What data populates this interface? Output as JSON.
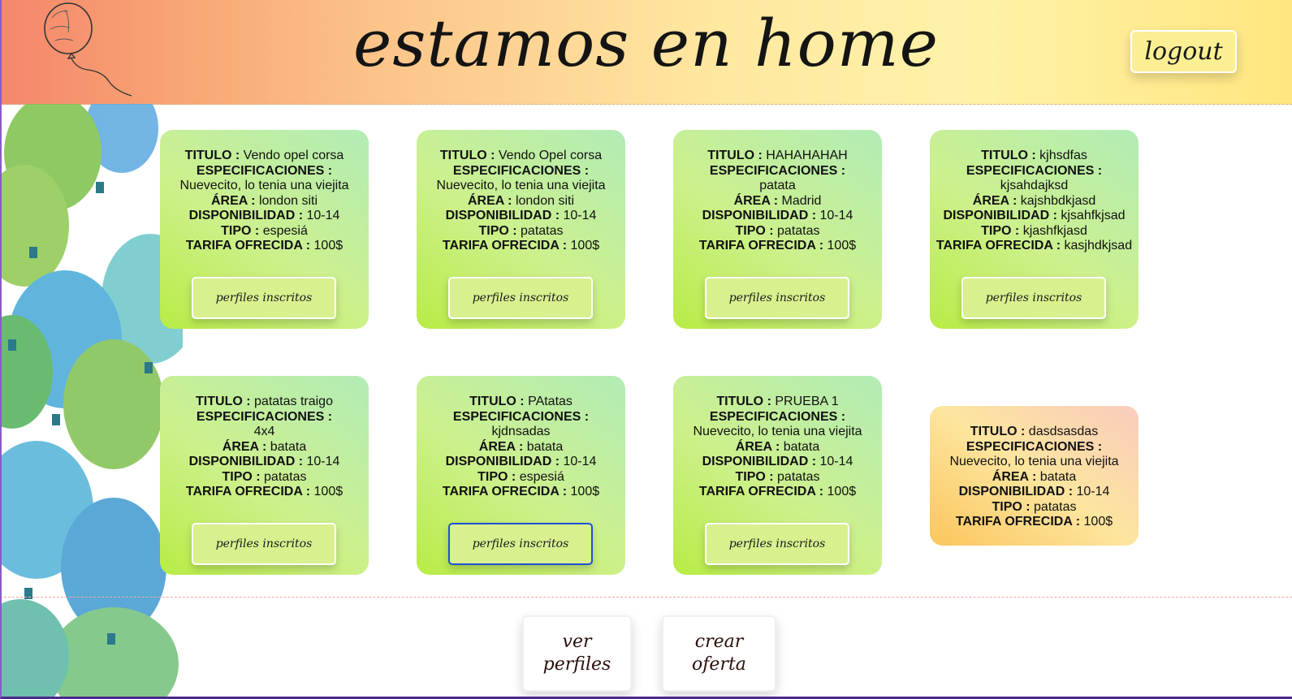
{
  "header": {
    "title": "estamos en home",
    "logout_label": "logout"
  },
  "labels": {
    "titulo": "TITULO :",
    "especificaciones": "ESPECIFICACIONES :",
    "area": "ÁREA :",
    "disponibilidad": "DISPONIBILIDAD :",
    "tipo": "TIPO :",
    "tarifa": "TARIFA OFRECIDA :"
  },
  "offers": [
    {
      "titulo": "Vendo opel corsa",
      "especificaciones": "Nuevecito, lo tenia una viejita",
      "area": "london siti",
      "disponibilidad": "10-14",
      "tipo": "espesiá",
      "tarifa": "100$",
      "button": "perfiles inscritos"
    },
    {
      "titulo": "Vendo Opel corsa",
      "especificaciones": "Nuevecito, lo tenia una viejita",
      "area": "london siti",
      "disponibilidad": "10-14",
      "tipo": "patatas",
      "tarifa": "100$",
      "button": "perfiles inscritos"
    },
    {
      "titulo": "HAHAHAHAH",
      "especificaciones": "patata",
      "area": "Madrid",
      "disponibilidad": "10-14",
      "tipo": "patatas",
      "tarifa": "100$",
      "button": "perfiles inscritos"
    },
    {
      "titulo": "kjhsdfas",
      "especificaciones": "kjsahdajksd",
      "area": "kajshbdkjasd",
      "disponibilidad": "kjsahfkjsad",
      "tipo": "kjashfkjasd",
      "tarifa": "kasjhdkjsad",
      "button": "perfiles inscritos"
    },
    {
      "titulo": "patatas traigo",
      "especificaciones": "4x4",
      "area": "batata",
      "disponibilidad": "10-14",
      "tipo": "patatas",
      "tarifa": "100$",
      "button": "perfiles inscritos"
    },
    {
      "titulo": "PAtatas",
      "especificaciones": "kjdnsadas",
      "area": "batata",
      "disponibilidad": "10-14",
      "tipo": "espesiá",
      "tarifa": "100$",
      "button": "perfiles inscritos"
    },
    {
      "titulo": "PRUEBA 1",
      "especificaciones": "Nuevecito, lo tenia una viejita",
      "area": "batata",
      "disponibilidad": "10-14",
      "tipo": "patatas",
      "tarifa": "100$",
      "button": "perfiles inscritos"
    },
    {
      "titulo": "dasdsasdas",
      "especificaciones": "Nuevecito, lo tenia una viejita",
      "area": "batata",
      "disponibilidad": "10-14",
      "tipo": "patatas",
      "tarifa": "100$"
    }
  ],
  "footer": {
    "ver_perfiles": "ver perfiles",
    "crear_oferta": "crear oferta"
  },
  "colors": {
    "card_green": "#c6ef7a",
    "card_peach": "#fcd98a",
    "focus_outline": "#1f4fd8"
  },
  "icons": {
    "header_logo": "balloon-sketch-icon",
    "side_decoration": "watercolor-balloons"
  }
}
